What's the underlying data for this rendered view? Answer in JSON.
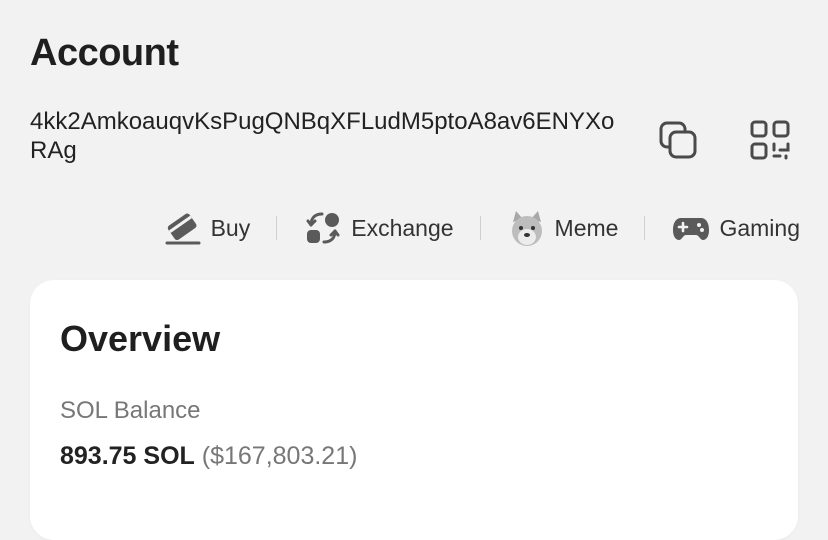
{
  "header": {
    "title": "Account"
  },
  "account": {
    "address": "4kk2AmkoauqvKsPugQNBqXFLudM5ptoA8av6ENYXoRAg",
    "copy_icon": "copy-icon",
    "qr_icon": "qr-code-icon"
  },
  "quick_actions": [
    {
      "label": "Buy",
      "icon": "buy-card-icon"
    },
    {
      "label": "Exchange",
      "icon": "exchange-icon"
    },
    {
      "label": "Meme",
      "icon": "doge-meme-icon"
    },
    {
      "label": "Gaming",
      "icon": "gamepad-icon"
    }
  ],
  "overview": {
    "title": "Overview",
    "sol_balance_label": "SOL Balance",
    "sol_amount": "893.75 SOL",
    "sol_usd": "($167,803.21)"
  },
  "colors": {
    "background": "#f2f2f2",
    "card": "#ffffff",
    "text_primary": "#1f1f1f",
    "text_secondary": "#777777"
  }
}
